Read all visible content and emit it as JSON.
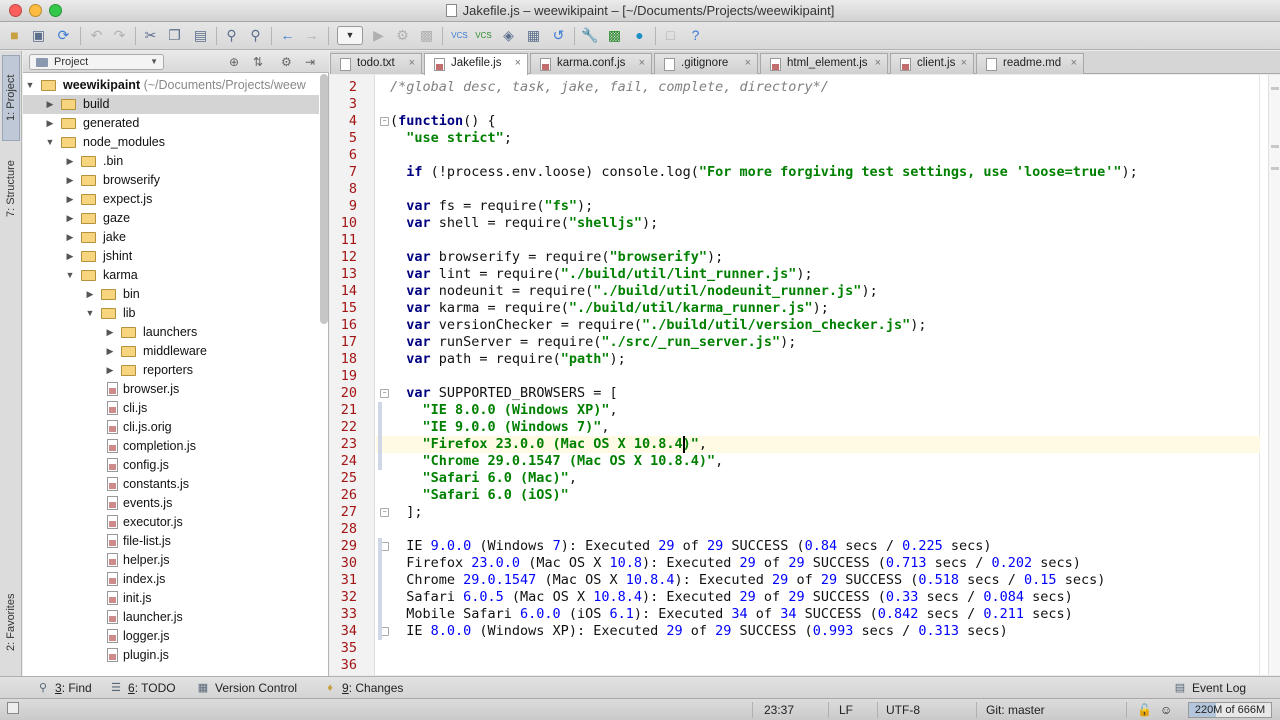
{
  "window": {
    "title": "Jakefile.js – weewikipaint – [~/Documents/Projects/weewikipaint]"
  },
  "sidebar_left": {
    "tabs": [
      "1: Project",
      "7: Structure",
      "2: Favorites"
    ]
  },
  "project_panel": {
    "view_selector": "Project",
    "root_label": "weewikipaint",
    "root_path": "(~/Documents/Projects/weew",
    "items": [
      {
        "label": "build",
        "type": "folder",
        "depth": 1,
        "expanded": false,
        "selected": true
      },
      {
        "label": "generated",
        "type": "folder",
        "depth": 1,
        "expanded": false
      },
      {
        "label": "node_modules",
        "type": "folder",
        "depth": 1,
        "expanded": true
      },
      {
        "label": ".bin",
        "type": "folder",
        "depth": 2,
        "expanded": false
      },
      {
        "label": "browserify",
        "type": "folder",
        "depth": 2,
        "expanded": false
      },
      {
        "label": "expect.js",
        "type": "folder",
        "depth": 2,
        "expanded": false
      },
      {
        "label": "gaze",
        "type": "folder",
        "depth": 2,
        "expanded": false
      },
      {
        "label": "jake",
        "type": "folder",
        "depth": 2,
        "expanded": false
      },
      {
        "label": "jshint",
        "type": "folder",
        "depth": 2,
        "expanded": false
      },
      {
        "label": "karma",
        "type": "folder",
        "depth": 2,
        "expanded": true
      },
      {
        "label": "bin",
        "type": "folder",
        "depth": 3,
        "expanded": false
      },
      {
        "label": "lib",
        "type": "folder",
        "depth": 3,
        "expanded": true
      },
      {
        "label": "launchers",
        "type": "folder",
        "depth": 4,
        "expanded": false
      },
      {
        "label": "middleware",
        "type": "folder",
        "depth": 4,
        "expanded": false
      },
      {
        "label": "reporters",
        "type": "folder",
        "depth": 4,
        "expanded": false
      },
      {
        "label": "browser.js",
        "type": "file",
        "depth": 4
      },
      {
        "label": "cli.js",
        "type": "file",
        "depth": 4
      },
      {
        "label": "cli.js.orig",
        "type": "file",
        "depth": 4
      },
      {
        "label": "completion.js",
        "type": "file",
        "depth": 4
      },
      {
        "label": "config.js",
        "type": "file",
        "depth": 4
      },
      {
        "label": "constants.js",
        "type": "file",
        "depth": 4
      },
      {
        "label": "events.js",
        "type": "file",
        "depth": 4
      },
      {
        "label": "executor.js",
        "type": "file",
        "depth": 4
      },
      {
        "label": "file-list.js",
        "type": "file",
        "depth": 4
      },
      {
        "label": "helper.js",
        "type": "file",
        "depth": 4
      },
      {
        "label": "index.js",
        "type": "file",
        "depth": 4
      },
      {
        "label": "init.js",
        "type": "file",
        "depth": 4
      },
      {
        "label": "launcher.js",
        "type": "file",
        "depth": 4
      },
      {
        "label": "logger.js",
        "type": "file",
        "depth": 4
      },
      {
        "label": "plugin.js",
        "type": "file",
        "depth": 4
      }
    ]
  },
  "editor_tabs": [
    {
      "label": "todo.txt",
      "icon": "text-file-icon",
      "active": false
    },
    {
      "label": "Jakefile.js",
      "icon": "js-file-icon",
      "active": true
    },
    {
      "label": "karma.conf.js",
      "icon": "js-file-icon",
      "active": false
    },
    {
      "label": ".gitignore",
      "icon": "text-file-icon",
      "active": false
    },
    {
      "label": "html_element.js",
      "icon": "js-file-icon",
      "active": false
    },
    {
      "label": "client.js",
      "icon": "js-file-icon",
      "active": false
    },
    {
      "label": "readme.md",
      "icon": "text-file-icon",
      "active": false
    }
  ],
  "editor": {
    "current_line": 23,
    "lines": [
      {
        "n": 2,
        "html": "<span class=\"cm\">/*global desc, task, jake, fail, complete, directory*/</span>"
      },
      {
        "n": 3,
        "html": ""
      },
      {
        "n": 4,
        "html": "(<span class=\"kw\">function</span>() {"
      },
      {
        "n": 5,
        "html": "  <span class=\"str\">\"use strict\"</span>;"
      },
      {
        "n": 6,
        "html": ""
      },
      {
        "n": 7,
        "html": "  <span class=\"kw\">if</span> (!process.env.loose) console.log(<span class=\"str\">\"For more forgiving test settings, use 'loose=true'\"</span>);"
      },
      {
        "n": 8,
        "html": ""
      },
      {
        "n": 9,
        "html": "  <span class=\"kw\">var</span> fs = require(<span class=\"str\">\"fs\"</span>);"
      },
      {
        "n": 10,
        "html": "  <span class=\"kw\">var</span> shell = require(<span class=\"str\">\"shelljs\"</span>);"
      },
      {
        "n": 11,
        "html": ""
      },
      {
        "n": 12,
        "html": "  <span class=\"kw\">var</span> browserify = require(<span class=\"str\">\"browserify\"</span>);"
      },
      {
        "n": 13,
        "html": "  <span class=\"kw\">var</span> lint = require(<span class=\"str\">\"./build/util/lint_runner.js\"</span>);"
      },
      {
        "n": 14,
        "html": "  <span class=\"kw\">var</span> nodeunit = require(<span class=\"str\">\"./build/util/nodeunit_runner.js\"</span>);"
      },
      {
        "n": 15,
        "html": "  <span class=\"kw\">var</span> karma = require(<span class=\"str\">\"./build/util/karma_runner.js\"</span>);"
      },
      {
        "n": 16,
        "html": "  <span class=\"kw\">var</span> versionChecker = require(<span class=\"str\">\"./build/util/version_checker.js\"</span>);"
      },
      {
        "n": 17,
        "html": "  <span class=\"kw\">var</span> runServer = require(<span class=\"str\">\"./src/_run_server.js\"</span>);"
      },
      {
        "n": 18,
        "html": "  <span class=\"kw\">var</span> path = require(<span class=\"str\">\"path\"</span>);"
      },
      {
        "n": 19,
        "html": ""
      },
      {
        "n": 20,
        "html": "  <span class=\"kw\">var</span> SUPPORTED_BROWSERS = ["
      },
      {
        "n": 21,
        "html": "    <span class=\"str\">\"IE 8.0.0 (Windows XP)\"</span>,"
      },
      {
        "n": 22,
        "html": "    <span class=\"str\">\"IE 9.0.0 (Windows 7)\"</span>,"
      },
      {
        "n": 23,
        "html": "    <span class=\"str\">\"Firefox 23.0.0 (Mac OS X 10.8.4)\"</span>,"
      },
      {
        "n": 24,
        "html": "    <span class=\"str\">\"Chrome 29.0.1547 (Mac OS X 10.8.4)\"</span>,"
      },
      {
        "n": 25,
        "html": "    <span class=\"str\">\"Safari 6.0 (Mac)\"</span>,"
      },
      {
        "n": 26,
        "html": "    <span class=\"str\">\"Safari 6.0 (iOS)\"</span>"
      },
      {
        "n": 27,
        "html": "  ];"
      },
      {
        "n": 28,
        "html": ""
      },
      {
        "n": 29,
        "html": "  IE <span class=\"num\">9.0.0</span> (Windows <span class=\"num\">7</span>): Executed <span class=\"num\">29</span> of <span class=\"num\">29</span> SUCCESS (<span class=\"num\">0.84</span> secs / <span class=\"num\">0.225</span> secs)"
      },
      {
        "n": 30,
        "html": "  Firefox <span class=\"num\">23.0.0</span> (Mac OS X <span class=\"num\">10.8</span>): Executed <span class=\"num\">29</span> of <span class=\"num\">29</span> SUCCESS (<span class=\"num\">0.713</span> secs / <span class=\"num\">0.202</span> secs)"
      },
      {
        "n": 31,
        "html": "  Chrome <span class=\"num\">29.0.1547</span> (Mac OS X <span class=\"num\">10.8.4</span>): Executed <span class=\"num\">29</span> of <span class=\"num\">29</span> SUCCESS (<span class=\"num\">0.518</span> secs / <span class=\"num\">0.15</span> secs)"
      },
      {
        "n": 32,
        "html": "  Safari <span class=\"num\">6.0.5</span> (Mac OS X <span class=\"num\">10.8.4</span>): Executed <span class=\"num\">29</span> of <span class=\"num\">29</span> SUCCESS (<span class=\"num\">0.33</span> secs / <span class=\"num\">0.084</span> secs)"
      },
      {
        "n": 33,
        "html": "  Mobile Safari <span class=\"num\">6.0.0</span> (iOS <span class=\"num\">6.1</span>): Executed <span class=\"num\">34</span> of <span class=\"num\">34</span> SUCCESS (<span class=\"num\">0.842</span> secs / <span class=\"num\">0.211</span> secs)"
      },
      {
        "n": 34,
        "html": "  IE <span class=\"num\">8.0.0</span> (Windows XP): Executed <span class=\"num\">29</span> of <span class=\"num\">29</span> SUCCESS (<span class=\"num\">0.993</span> secs / <span class=\"num\">0.313</span> secs)"
      },
      {
        "n": 35,
        "html": ""
      },
      {
        "n": 36,
        "html": ""
      }
    ]
  },
  "tool_windows": {
    "find_num": "3",
    "find_label": ": Find",
    "todo_num": "6",
    "todo_label": ": TODO",
    "vcs_label": "Version Control",
    "changes_num": "9",
    "changes_label": ": Changes",
    "event_log": "Event Log"
  },
  "status": {
    "position": "23:37",
    "line_sep": "LF",
    "encoding": "UTF-8",
    "vcs_branch": "Git: master",
    "memory": "220M of 666M",
    "memory_used_fraction": 0.33
  },
  "colors": {
    "traffic_close": "#fc605c",
    "traffic_min": "#fdbc40",
    "traffic_max": "#34c84a"
  }
}
